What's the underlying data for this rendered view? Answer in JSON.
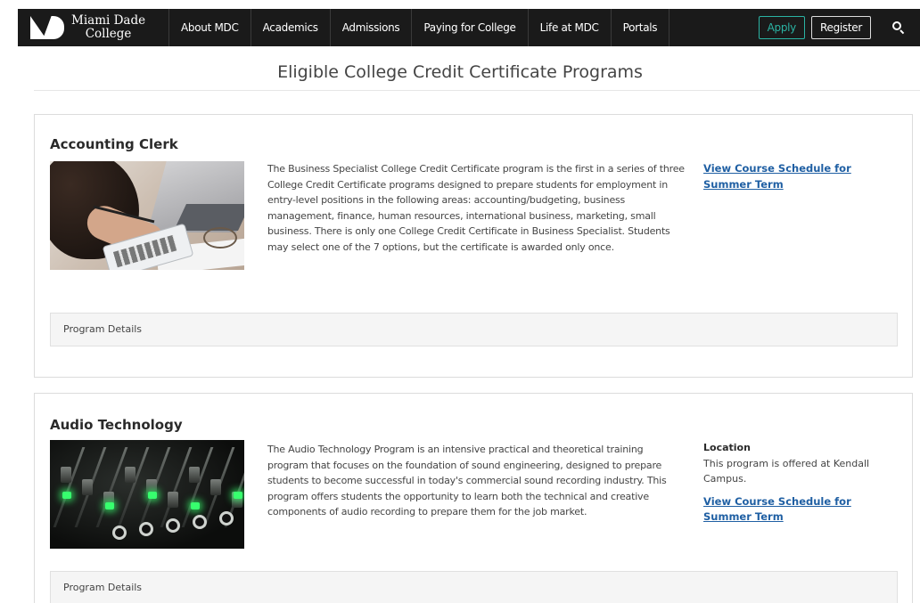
{
  "nav": {
    "logo_line1": "Miami Dade",
    "logo_line2": "College",
    "items": [
      {
        "label": "About MDC"
      },
      {
        "label": "Academics"
      },
      {
        "label": "Admissions"
      },
      {
        "label": "Paying for College"
      },
      {
        "label": "Life at MDC"
      },
      {
        "label": "Portals"
      }
    ],
    "apply_label": "Apply",
    "register_label": "Register",
    "search_icon": "search-icon",
    "accent_color": "#2bb3a3",
    "background_color": "#1a1a1a"
  },
  "page": {
    "title": "Eligible College Credit Certificate Programs"
  },
  "programs": [
    {
      "title": "Accounting Clerk",
      "description": "The Business Specialist College Credit Certificate program is the first in a series of three College Credit Certificate programs designed to prepare students for employment in entry-level positions in the following areas: accounting/budgeting, business management, finance, human resources, international business, marketing, small business. There is only one College Credit Certificate in Business Specialist. Students may select one of the 7 options, but the certificate is awarded only once.",
      "schedule_link": "View Course Schedule for Summer Term",
      "details_label": "Program Details"
    },
    {
      "title": "Audio Technology",
      "description": "The Audio Technology Program is an intensive practical and theoretical training program that focuses on the foundation of sound engineering, designed to prepare students to become successful in today's commercial sound recording industry. This program offers students the opportunity to learn both the technical and creative components of audio recording to prepare them for the job market.",
      "location_heading": "Location",
      "location_text": "This program is offered at Kendall Campus.",
      "schedule_link": "View Course Schedule for Summer Term",
      "details_label": "Program Details"
    }
  ],
  "colors": {
    "link": "#1f5fa3",
    "details_bg": "#f5f5f5"
  }
}
